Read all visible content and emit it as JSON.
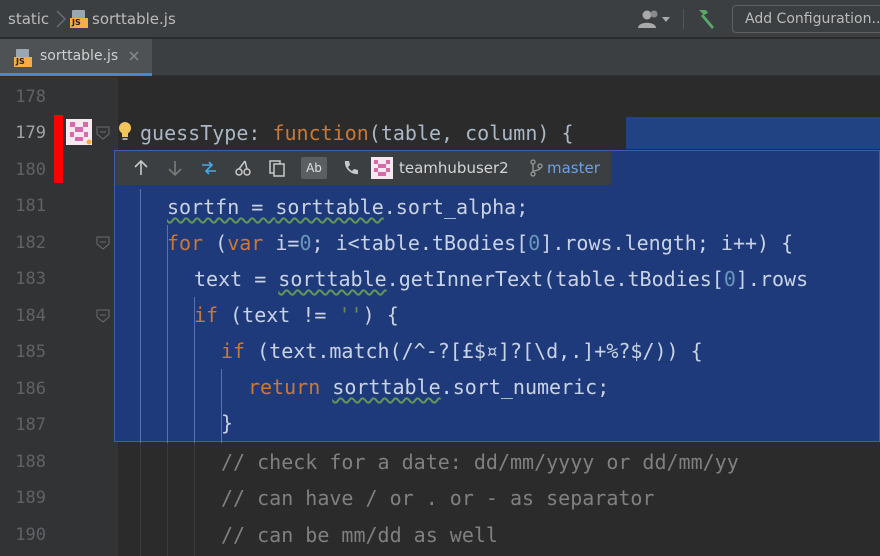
{
  "breadcrumb": {
    "folder": "static",
    "file": "sorttable.js"
  },
  "toolbar": {
    "add_configuration_label": "Add Configuration..."
  },
  "tab": {
    "label": "sorttable.js"
  },
  "popup": {
    "author": "teamhubuser2",
    "branch": "master",
    "ab_label": "Ab"
  },
  "editor": {
    "line_numbers": [
      "178",
      "179",
      "180",
      "181",
      "182",
      "183",
      "184",
      "185",
      "186",
      "187",
      "188",
      "189",
      "190"
    ],
    "current_line": "179",
    "lines": {
      "l179": {
        "name": "guessType",
        "colon": ": ",
        "kw": "function",
        "rest": "(table, column) {"
      },
      "l181": {
        "a": "sortfn = ",
        "b": "sorttable",
        "c": ".sort_alpha;"
      },
      "l182": {
        "kw1": "for",
        "a": " (",
        "kw2": "var",
        "b": " i=",
        "n1": "0",
        "c": "; i<table.tBodies[",
        "n2": "0",
        "d": "].rows.length; i++) {"
      },
      "l183": {
        "a": "text = ",
        "b": "sorttable",
        "c": ".getInnerText(table.tBodies[",
        "n": "0",
        "d": "].rows"
      },
      "l184": {
        "kw": "if",
        "a": " (text != ",
        "s": "''",
        "b": ") {"
      },
      "l185": {
        "kw": "if",
        "a": " (text.match(/^-?[£$¤]?[\\d,.]+%?$/)) {"
      },
      "l186": {
        "kw": "return",
        "a": " ",
        "b": "sorttable",
        "c": ".sort_numeric;"
      },
      "l187": {
        "a": "}"
      },
      "l188": "// check for a date: dd/mm/yyyy or dd/mm/yy",
      "l189": "// can have / or . or - as separator",
      "l190": "// can be mm/dd as well"
    }
  },
  "colors": {
    "background": "#2b2b2b",
    "gutter": "#313335",
    "keyword": "#cc7832",
    "number": "#6897bb",
    "string": "#6a8759",
    "comment": "#808080",
    "function_name": "#ffc66d",
    "change_marker": "#ff0000",
    "popup_bg": "#1f3a7a",
    "tab_underline": "#4a88c7"
  },
  "icons": [
    "chevron-right-icon",
    "js-file-icon",
    "user-dropdown-icon",
    "hammer-icon",
    "close-icon",
    "fold-icon",
    "lightbulb-icon",
    "avatar-icon",
    "arrow-up-icon",
    "arrow-down-icon",
    "compare-icon",
    "rollback-icon",
    "copy-icon",
    "ab-icon",
    "phone-icon",
    "branch-icon"
  ]
}
